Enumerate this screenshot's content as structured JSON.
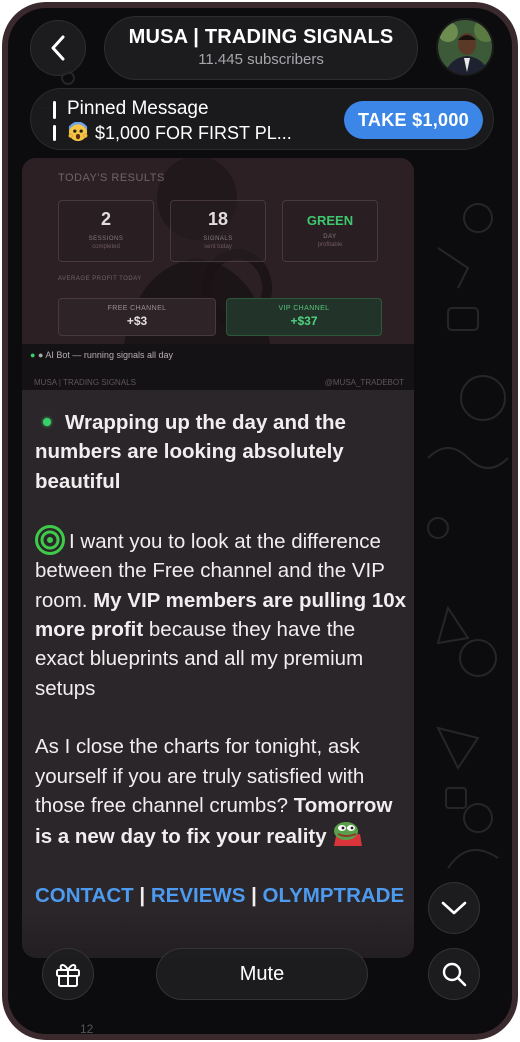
{
  "header": {
    "channel_name": "MUSA | TRADING SIGNALS",
    "subscribers": "11.445 subscribers"
  },
  "pinned": {
    "title": "Pinned Message",
    "text": "$1,000 FOR FIRST PL...",
    "cta": "TAKE $1,000"
  },
  "media": {
    "results_title": "TODAY'S RESULTS",
    "stats": [
      {
        "value": "2",
        "label": "SESSIONS",
        "sub": "completed"
      },
      {
        "value": "18",
        "label": "SIGNALS",
        "sub": "sent today"
      },
      {
        "value": "GREEN",
        "label": "DAY",
        "sub": "profitable"
      }
    ],
    "avg_label": "AVERAGE PROFIT TODAY",
    "free_label": "FREE CHANNEL",
    "free_value": "+$3",
    "vip_label": "VIP CHANNEL",
    "vip_value": "+$37",
    "bot_line": "AI Bot — running signals all day",
    "footer_left": "MUSA | TRADING SIGNALS",
    "footer_right": "@MUSA_TRADEBOT"
  },
  "message": {
    "line1": "Wrapping up the day and the numbers are looking absolutely beautiful",
    "p2_start": "I want you to look at the difference between the Free channel and the VIP room.",
    "p2_bold": "My VIP members are pulling 10x more profit",
    "p2_end": "because they have the exact blueprints and all my premium setups",
    "p3_start": "As I close the charts for tonight, ask yourself if you are truly satisfied with those free channel crumbs?",
    "p3_bold": "Tomorrow is a new day to fix your reality",
    "links": [
      "CONTACT",
      "REVIEWS",
      "OLYMPTRADE"
    ],
    "separator": "|"
  },
  "bottom": {
    "mute": "Mute",
    "reaction_count": "12"
  },
  "colors": {
    "accent": "#3b86e6",
    "link": "#4d9bf0",
    "bubble": "#2b2629",
    "background": "#0c0c0e"
  },
  "icons": [
    "back-arrow-icon",
    "avatar",
    "shocked-face-emoji",
    "green-dot-icon",
    "target-icon",
    "pepe-emoji",
    "gift-icon",
    "chevron-down-icon",
    "search-icon"
  ]
}
